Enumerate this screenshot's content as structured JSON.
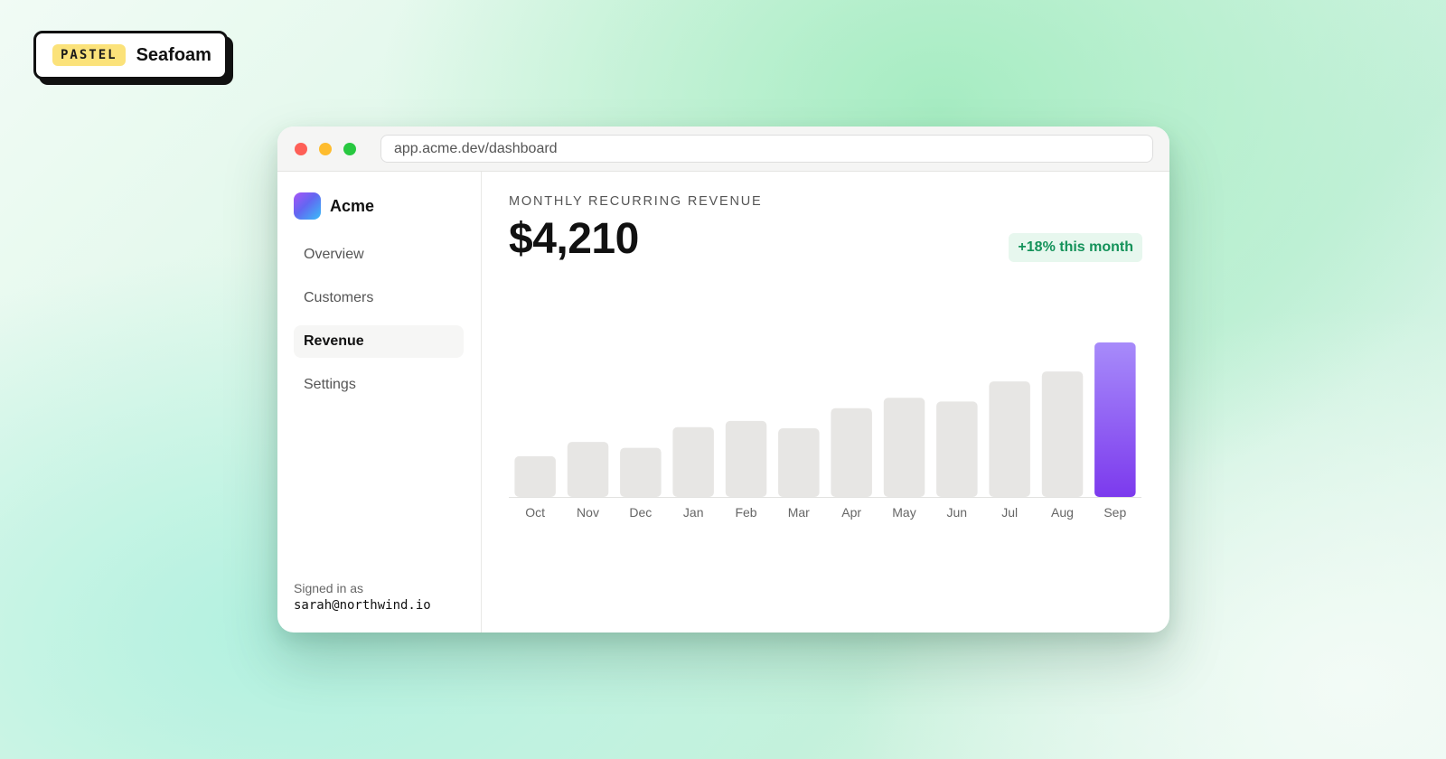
{
  "theme": {
    "pill": "PASTEL",
    "name": "Seafoam"
  },
  "browser": {
    "url": "app.acme.dev/dashboard"
  },
  "sidebar": {
    "brand": "Acme",
    "items": [
      {
        "label": "Overview",
        "active": false
      },
      {
        "label": "Customers",
        "active": false
      },
      {
        "label": "Revenue",
        "active": true
      },
      {
        "label": "Settings",
        "active": false
      }
    ],
    "signed_in_label": "Signed in as",
    "signed_in_email": "sarah@northwind.io"
  },
  "main": {
    "metric_label": "MONTHLY RECURRING REVENUE",
    "metric_value": "$4,210",
    "delta": "+18% this month"
  },
  "colors": {
    "bar": "#e7e6e4",
    "highlight_top": "#a78bfa",
    "highlight_bottom": "#7c3aed",
    "axis": "#e2e2e0",
    "tick_label": "#666666",
    "accent_green": "#14925a"
  },
  "chart_data": {
    "type": "bar",
    "categories": [
      "Oct",
      "Nov",
      "Dec",
      "Jan",
      "Feb",
      "Mar",
      "Apr",
      "May",
      "Jun",
      "Jul",
      "Aug",
      "Sep"
    ],
    "values": [
      1110,
      1500,
      1340,
      1900,
      2070,
      1870,
      2420,
      2700,
      2600,
      3150,
      3420,
      4210
    ],
    "highlight_index": 11,
    "ylim": [
      0,
      4210
    ],
    "grid": false,
    "title": "",
    "xlabel": "",
    "ylabel": ""
  }
}
